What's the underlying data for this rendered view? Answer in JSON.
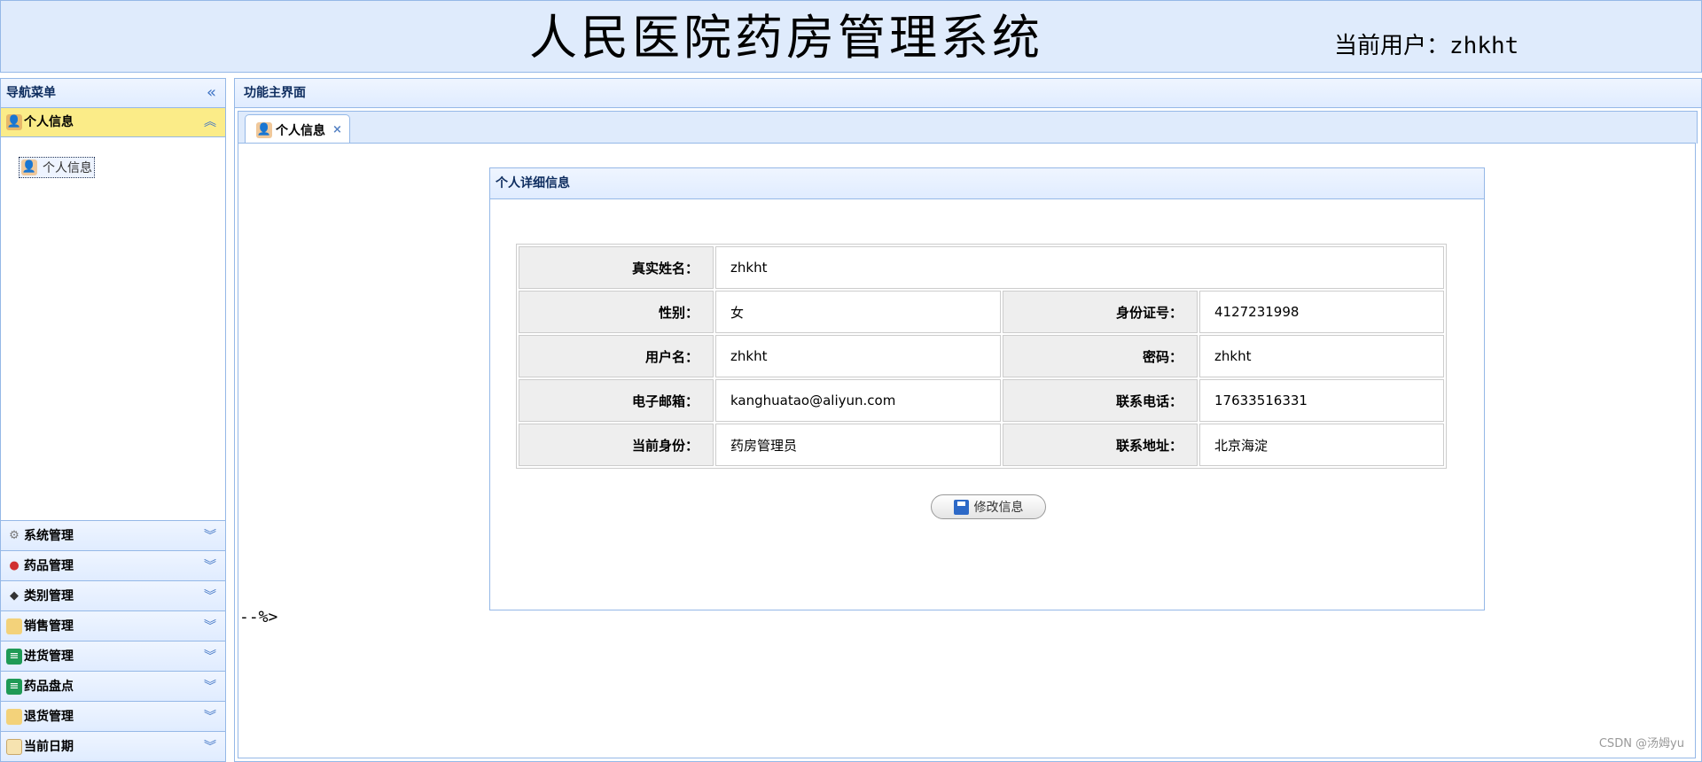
{
  "header": {
    "title": "人民医院药房管理系统",
    "current_user_label": "当前用户：",
    "current_user": "zhkht"
  },
  "nav": {
    "title": "导航菜单",
    "collapse_icon": "double-chevron-left-icon",
    "active_section": {
      "label": "个人信息",
      "icon": "user-group-icon",
      "items": [
        {
          "label": "个人信息",
          "icon": "user-icon"
        }
      ]
    },
    "sections": [
      {
        "label": "系统管理",
        "icon": "gear-icon"
      },
      {
        "label": "药品管理",
        "icon": "pill-icon"
      },
      {
        "label": "类别管理",
        "icon": "tag-icon"
      },
      {
        "label": "销售管理",
        "icon": "folder-icon"
      },
      {
        "label": "进货管理",
        "icon": "list-icon"
      },
      {
        "label": "药品盘点",
        "icon": "list-icon"
      },
      {
        "label": "退货管理",
        "icon": "folder-icon"
      },
      {
        "label": "当前日期",
        "icon": "calendar-icon"
      }
    ]
  },
  "main": {
    "title": "功能主界面",
    "tab": {
      "label": "个人信息",
      "close": "×"
    },
    "panel_title": "个人详细信息",
    "rows": [
      [
        {
          "label": "真实姓名：",
          "value": "zhkht"
        }
      ],
      [
        {
          "label": "性别：",
          "value": "女"
        },
        {
          "label": "身份证号：",
          "value": "4127231998"
        }
      ],
      [
        {
          "label": "用户名：",
          "value": "zhkht"
        },
        {
          "label": "密码：",
          "value": "zhkht"
        }
      ],
      [
        {
          "label": "电子邮箱：",
          "value": "kanghuatao@aliyun.com"
        },
        {
          "label": "联系电话：",
          "value": "17633516331"
        }
      ],
      [
        {
          "label": "当前身份：",
          "value": "药房管理员"
        },
        {
          "label": "联系地址：",
          "value": "北京海淀"
        }
      ]
    ],
    "edit_button": "修改信息",
    "stray_text": "--%>"
  },
  "watermark": "CSDN @汤姆yu",
  "colors": {
    "accent": "#95b8e7",
    "header_bg": "#dfebfc",
    "active_section": "#fbec88"
  }
}
